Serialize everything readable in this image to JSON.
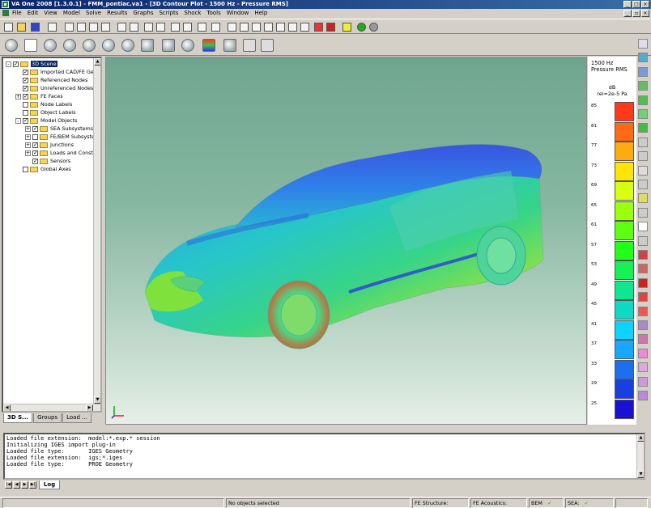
{
  "window": {
    "title": "VA One 2008 [1.3.0.1] - FMM_pontiac.va1 - [3D Contour Plot - 1500 Hz - Pressure RMS]"
  },
  "menu": [
    "File",
    "Edit",
    "View",
    "Model",
    "Solve",
    "Results",
    "Graphs",
    "Scripts",
    "Shock",
    "Tools",
    "Window",
    "Help"
  ],
  "tree": [
    {
      "label": "3D Scene",
      "depth": 0,
      "exp": "-",
      "check": true,
      "selected": true
    },
    {
      "label": "Imported CAD/FE Geom",
      "depth": 1,
      "check": true
    },
    {
      "label": "Referenced Nodes",
      "depth": 1,
      "check": true
    },
    {
      "label": "Unreferenced Nodes",
      "depth": 1,
      "check": true
    },
    {
      "label": "FE Faces",
      "depth": 1,
      "exp": "+",
      "check": true
    },
    {
      "label": "Node Labels",
      "depth": 1,
      "check": false
    },
    {
      "label": "Object Labels",
      "depth": 1,
      "check": false
    },
    {
      "label": "Model Objects",
      "depth": 1,
      "exp": "-",
      "check": true
    },
    {
      "label": "SEA Subsystems",
      "depth": 2,
      "exp": "+",
      "check": true
    },
    {
      "label": "FE/BEM Subsystems",
      "depth": 2,
      "exp": "+",
      "check": false
    },
    {
      "label": "Junctions",
      "depth": 2,
      "exp": "+",
      "check": true
    },
    {
      "label": "Loads and Constraints",
      "depth": 2,
      "exp": "+",
      "check": true
    },
    {
      "label": "Sensors",
      "depth": 2,
      "check": true
    },
    {
      "label": "Global Axes",
      "depth": 1,
      "check": false
    }
  ],
  "left_tabs": [
    "3D S...",
    "Groups",
    "Load ..."
  ],
  "legend": {
    "freq": "1500 Hz",
    "quantity": "Pressure RMS",
    "unit": "dB",
    "ref": "rel=2e-5 Pa",
    "labels": [
      "85",
      "81",
      "77",
      "73",
      "69",
      "65",
      "61",
      "57",
      "53",
      "49",
      "45",
      "41",
      "37",
      "33",
      "29",
      "25"
    ],
    "colors": [
      "#ff3a1a",
      "#ff6a14",
      "#ffaa10",
      "#ffe600",
      "#d8ff10",
      "#9cff10",
      "#5eff12",
      "#22ff1a",
      "#14f254",
      "#10e690",
      "#0fd9c2",
      "#0fd2ff",
      "#18a6ff",
      "#1a70f0",
      "#1a3fe0",
      "#1a10d4"
    ]
  },
  "log_lines": [
    "Loaded file extension:  model:*.exp.* session",
    "Initializing IGES import plug-in",
    "Loaded file type:       IGES Geometry",
    "Loaded file extension:  igs;*.iges",
    "Loaded file type:       PROE Geometry"
  ],
  "log_tab": "Log",
  "status": {
    "message": "No objects selected",
    "fe_structure": "FE Structure:",
    "fe_acoustics": "FE Acoustics:",
    "bem": "BEM",
    "sea": "SEA:"
  }
}
